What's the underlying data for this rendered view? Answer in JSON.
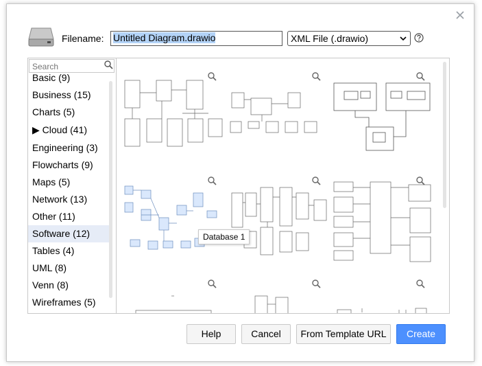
{
  "filename": {
    "label": "Filename:",
    "value": "Untitled Diagram.drawio",
    "format_selected": "XML File (.drawio)"
  },
  "icons": {
    "close": "close-icon",
    "drive": "hard-drive-icon",
    "help": "help-circle-icon",
    "search": "search-icon",
    "zoom": "magnifier-icon"
  },
  "search": {
    "placeholder": "Search"
  },
  "categories": [
    "Basic (9)",
    "Business (15)",
    "Charts (5)",
    "▶ Cloud (41)",
    "Engineering (3)",
    "Flowcharts (9)",
    "Maps (5)",
    "Network (13)",
    "Other (11)",
    "Software (12)",
    "Tables (4)",
    "UML (8)",
    "Venn (8)",
    "Wireframes (5)"
  ],
  "selected_category": "Software (12)",
  "tooltip": "Database 1",
  "buttons": {
    "help": "Help",
    "cancel": "Cancel",
    "template_url": "From Template URL",
    "create": "Create"
  },
  "colors": {
    "accent": "#4d90fe",
    "selection": "#b3d3f7",
    "selected_category_bg": "#e6ecf7",
    "thumb_blue_fill": "#dae8fc"
  }
}
